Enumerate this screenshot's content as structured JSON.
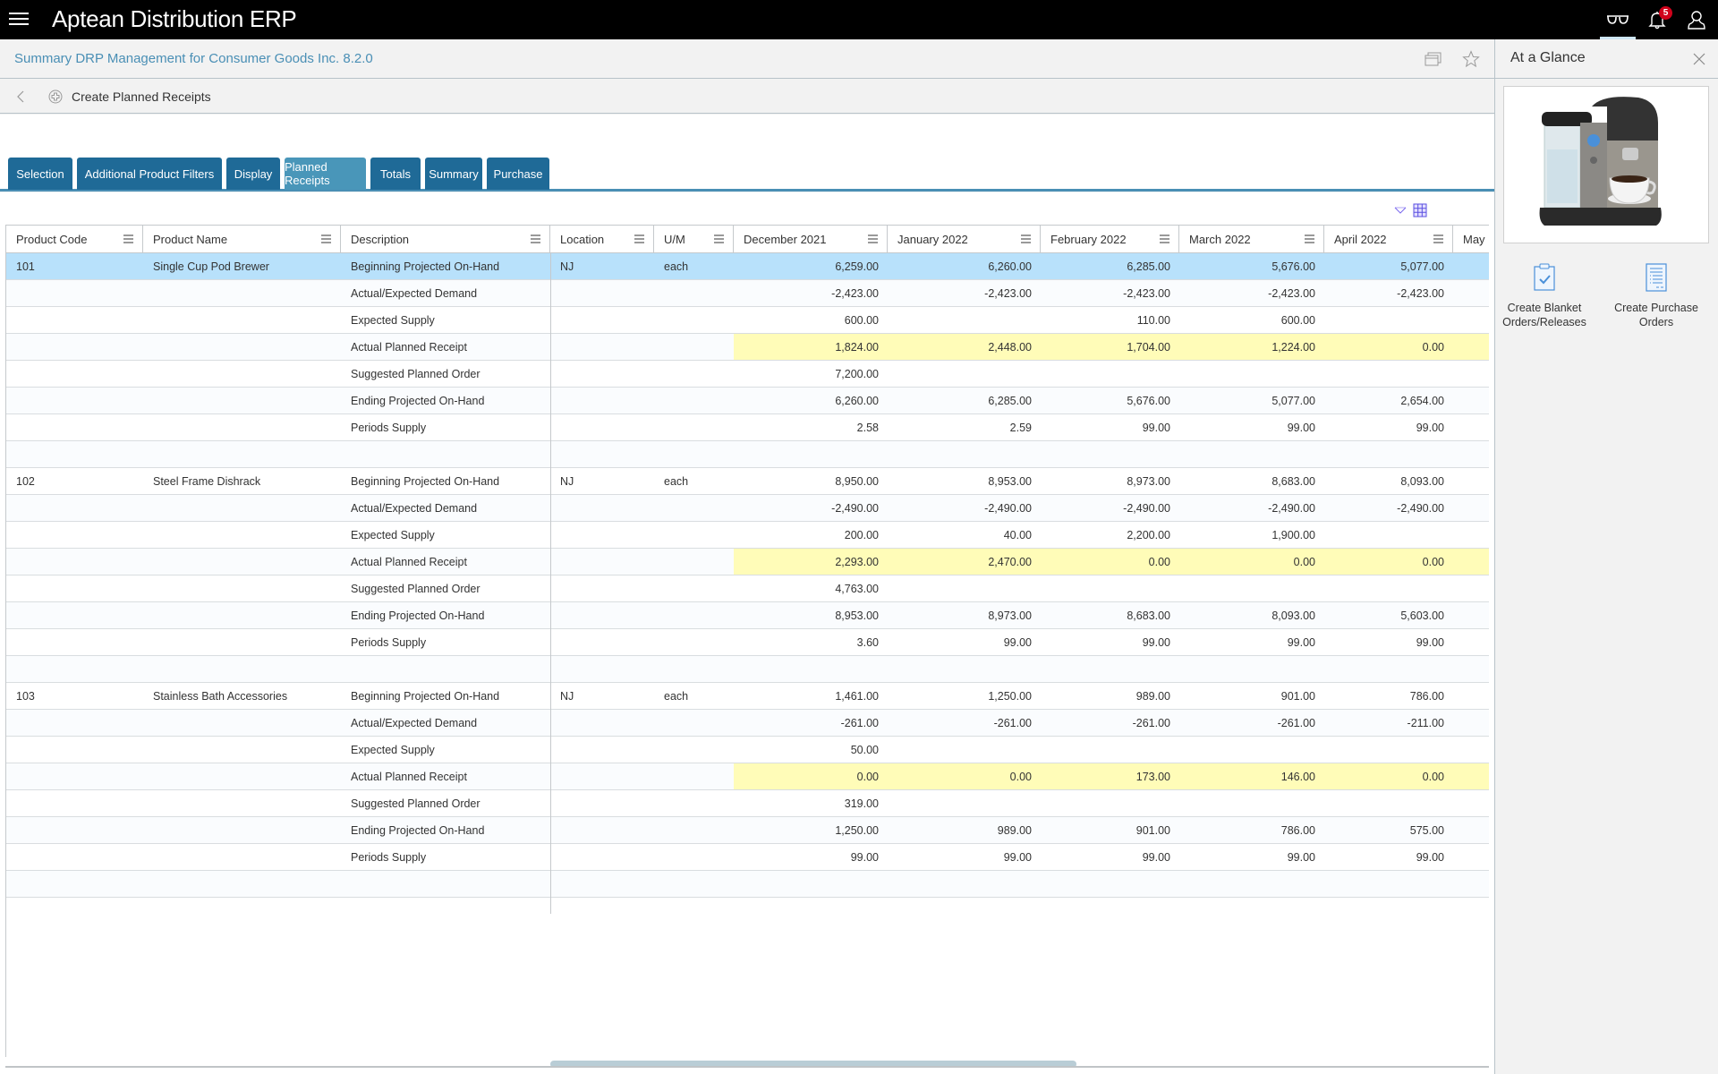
{
  "app": {
    "title": "Aptean Distribution ERP",
    "notification_count": "5",
    "icons": [
      "menu-icon",
      "glasses-icon",
      "bell-icon",
      "user-icon"
    ]
  },
  "page": {
    "title": "Summary DRP Management for Consumer Goods Inc. 8.2.0",
    "breadcrumb_label": "Create Planned Receipts"
  },
  "tabs": [
    {
      "label": "Selection",
      "active": false
    },
    {
      "label": "Additional Product Filters",
      "active": false
    },
    {
      "label": "Display",
      "active": false
    },
    {
      "label": "Planned Receipts",
      "active": true
    },
    {
      "label": "Totals",
      "active": false
    },
    {
      "label": "Summary",
      "active": false
    },
    {
      "label": "Purchase",
      "active": false
    }
  ],
  "grid": {
    "columns": [
      "Product Code",
      "Product Name",
      "Description",
      "Location",
      "U/M",
      "December 2021",
      "January 2022",
      "February 2022",
      "March 2022",
      "April 2022",
      "May"
    ],
    "products": [
      {
        "code": "101",
        "name": "Single Cup Pod Brewer",
        "location": "NJ",
        "um": "each",
        "selected": true,
        "rows": [
          {
            "description": "Beginning Projected On-Hand",
            "values": [
              "6,259.00",
              "6,260.00",
              "6,285.00",
              "5,676.00",
              "5,077.00"
            ]
          },
          {
            "description": "Actual/Expected Demand",
            "values": [
              "-2,423.00",
              "-2,423.00",
              "-2,423.00",
              "-2,423.00",
              "-2,423.00"
            ]
          },
          {
            "description": "Expected Supply",
            "values": [
              "600.00",
              "",
              "110.00",
              "600.00",
              ""
            ]
          },
          {
            "description": "Actual Planned Receipt",
            "values": [
              "1,824.00",
              "2,448.00",
              "1,704.00",
              "1,224.00",
              "0.00"
            ],
            "highlight": true
          },
          {
            "description": "Suggested Planned Order",
            "values": [
              "7,200.00",
              "",
              "",
              "",
              ""
            ]
          },
          {
            "description": "Ending Projected On-Hand",
            "values": [
              "6,260.00",
              "6,285.00",
              "5,676.00",
              "5,077.00",
              "2,654.00"
            ]
          },
          {
            "description": "Periods Supply",
            "values": [
              "2.58",
              "2.59",
              "99.00",
              "99.00",
              "99.00"
            ]
          }
        ]
      },
      {
        "code": "102",
        "name": "Steel Frame Dishrack",
        "location": "NJ",
        "um": "each",
        "selected": false,
        "rows": [
          {
            "description": "Beginning Projected On-Hand",
            "values": [
              "8,950.00",
              "8,953.00",
              "8,973.00",
              "8,683.00",
              "8,093.00"
            ]
          },
          {
            "description": "Actual/Expected Demand",
            "values": [
              "-2,490.00",
              "-2,490.00",
              "-2,490.00",
              "-2,490.00",
              "-2,490.00"
            ]
          },
          {
            "description": "Expected Supply",
            "values": [
              "200.00",
              "40.00",
              "2,200.00",
              "1,900.00",
              ""
            ]
          },
          {
            "description": "Actual Planned Receipt",
            "values": [
              "2,293.00",
              "2,470.00",
              "0.00",
              "0.00",
              "0.00"
            ],
            "highlight": true
          },
          {
            "description": "Suggested Planned Order",
            "values": [
              "4,763.00",
              "",
              "",
              "",
              ""
            ]
          },
          {
            "description": "Ending Projected On-Hand",
            "values": [
              "8,953.00",
              "8,973.00",
              "8,683.00",
              "8,093.00",
              "5,603.00"
            ]
          },
          {
            "description": "Periods Supply",
            "values": [
              "3.60",
              "99.00",
              "99.00",
              "99.00",
              "99.00"
            ]
          }
        ]
      },
      {
        "code": "103",
        "name": "Stainless Bath Accessories",
        "location": "NJ",
        "um": "each",
        "selected": false,
        "rows": [
          {
            "description": "Beginning Projected On-Hand",
            "values": [
              "1,461.00",
              "1,250.00",
              "989.00",
              "901.00",
              "786.00"
            ]
          },
          {
            "description": "Actual/Expected Demand",
            "values": [
              "-261.00",
              "-261.00",
              "-261.00",
              "-261.00",
              "-211.00"
            ]
          },
          {
            "description": "Expected Supply",
            "values": [
              "50.00",
              "",
              "",
              "",
              ""
            ]
          },
          {
            "description": "Actual Planned Receipt",
            "values": [
              "0.00",
              "0.00",
              "173.00",
              "146.00",
              "0.00"
            ],
            "highlight": true
          },
          {
            "description": "Suggested Planned Order",
            "values": [
              "319.00",
              "",
              "",
              "",
              ""
            ]
          },
          {
            "description": "Ending Projected On-Hand",
            "values": [
              "1,250.00",
              "989.00",
              "901.00",
              "786.00",
              "575.00"
            ]
          },
          {
            "description": "Periods Supply",
            "values": [
              "99.00",
              "99.00",
              "99.00",
              "99.00",
              "99.00"
            ]
          }
        ]
      }
    ]
  },
  "glance": {
    "title": "At a Glance",
    "image_alt": "Single Cup Pod Brewer coffee machine",
    "actions": [
      {
        "label": "Create Blanket Orders/Releases",
        "icon": "clipboard-check-icon"
      },
      {
        "label": "Create Purchase Orders",
        "icon": "document-list-icon"
      }
    ]
  },
  "colors": {
    "tab": "#1f6a97",
    "tab_active": "#4996b9",
    "selected_row": "#b8e1fb",
    "highlight_cell": "#fffcb8",
    "title_link": "#4a8fb5",
    "badge": "#d0021b"
  }
}
